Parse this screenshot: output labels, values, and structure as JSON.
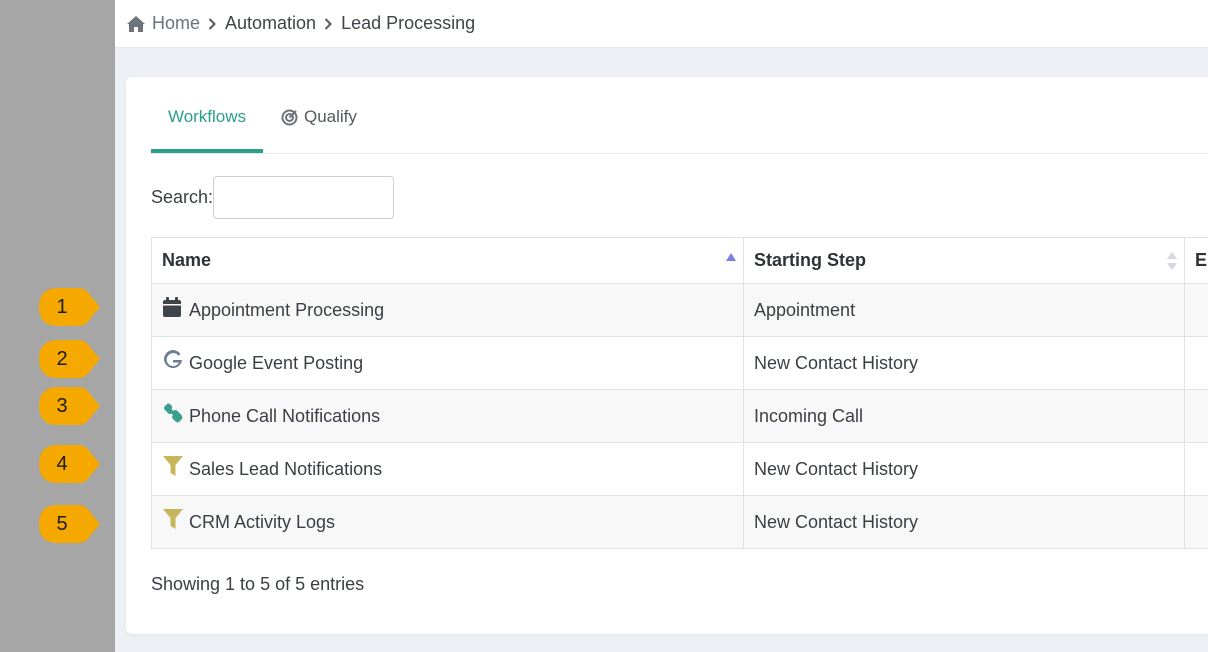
{
  "breadcrumb": {
    "home": "Home",
    "items": [
      "Automation",
      "Lead Processing"
    ]
  },
  "tabs": [
    {
      "label": "Workflows",
      "active": true
    },
    {
      "label": "Qualify",
      "icon": "bullseye-icon",
      "active": false
    }
  ],
  "search": {
    "label": "Search:",
    "value": ""
  },
  "table": {
    "columns": [
      "Name",
      "Starting Step",
      "Er"
    ],
    "rows": [
      {
        "name": "Appointment Processing",
        "icon": "calendar-icon",
        "step": "Appointment"
      },
      {
        "name": "Google Event Posting",
        "icon": "google-icon",
        "step": "New Contact History"
      },
      {
        "name": "Phone Call Notifications",
        "icon": "phone-icon",
        "step": "Incoming Call"
      },
      {
        "name": "Sales Lead Notifications",
        "icon": "funnel-icon",
        "step": "New Contact History"
      },
      {
        "name": "CRM Activity Logs",
        "icon": "funnel-icon",
        "step": "New Contact History"
      }
    ]
  },
  "footer": {
    "info": "Showing 1 to 5 of 5 entries"
  },
  "markers": [
    "1",
    "2",
    "3",
    "4",
    "5"
  ],
  "colors": {
    "accent": "#2aa08a",
    "marker": "#f5a800",
    "funnel": "#c8b45a",
    "sidebar": "#a6a6a6",
    "sort_active": "#7b7fe0"
  }
}
